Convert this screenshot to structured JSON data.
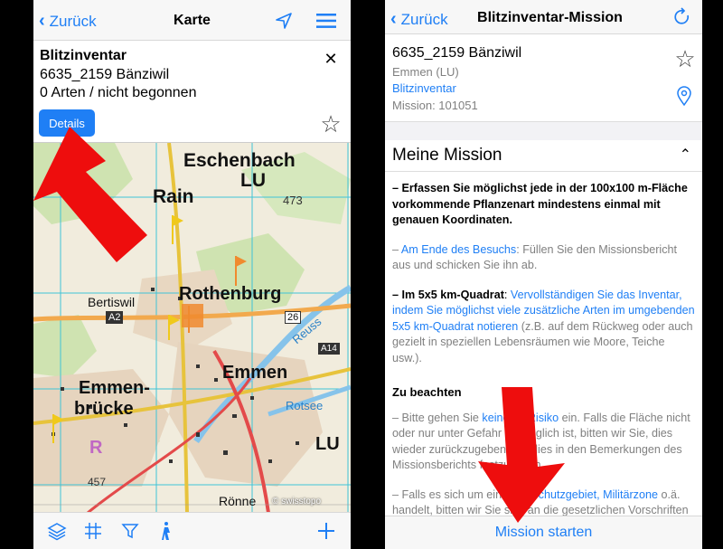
{
  "left": {
    "nav": {
      "back_label": "Zurück",
      "title": "Karte"
    },
    "info": {
      "title": "Blitzinventar",
      "square": "6635_2159 Bänziwil",
      "status": "0 Arten / nicht begonnen",
      "details_label": "Details",
      "close_glyph": "✕",
      "star_glyph": "☆"
    },
    "map": {
      "places": {
        "eschenbach": "Eschenbach",
        "lu1": "LU",
        "rain": "Rain",
        "n473": "473",
        "bertiswil": "Bertiswil",
        "rothenburg": "Rothenburg",
        "a2": "A2",
        "n26": "26",
        "reuss": "Reuss",
        "a14": "A14",
        "emmen": "Emmen",
        "emmenbruecke1": "Emmen-",
        "emmenbruecke2": "brücke",
        "rotsee": "Rotsee",
        "lu2": "LU",
        "n457": "457",
        "roenne": "Rönne",
        "r": "R",
        "copyright": "© swisstopo"
      }
    },
    "toolbar_icons": [
      "layers-icon",
      "grid-icon",
      "filter-icon",
      "walk-icon",
      "plus-icon"
    ],
    "arrow_color": "#ee0d0d"
  },
  "right": {
    "nav": {
      "back_label": "Zurück",
      "title": "Blitzinventar-Mission"
    },
    "summary": {
      "square": "6635_2159 Bänziwil",
      "municipality": "Emmen (LU)",
      "project": "Blitzinventar",
      "mission": "Mission: 101051"
    },
    "section": {
      "title": "Meine Mission",
      "chevron": "⌃"
    },
    "items": {
      "i1": "– Erfassen Sie möglichst jede in der 100x100 m-Fläche vorkommende Pflanzenart mindestens einmal mit genauen Koordinaten.",
      "i2_dash": "– ",
      "i2_link": "Am Ende des Besuchs",
      "i2_rest": ": Füllen Sie den Missionsbericht aus und schicken Sie ihn ab.",
      "i3_bold": "– Im 5x5 km-Quadrat",
      "i3_colon": ": ",
      "i3_link": "Vervollständigen Sie das Inventar, indem Sie möglichst viele zusätzliche Arten im umgebenden 5x5 km-Quadrat notieren",
      "i3_rest": " (z.B. auf dem Rückweg oder auch gezielt in speziellen Lebensräumen wie Moore, Teiche usw.).",
      "zu_beachten": "Zu beachten",
      "n1_a": "– Bitte gehen Sie ",
      "n1_link": "keinerlei Risiko",
      "n1_b": " ein. Falls die Fläche nicht oder nur unter Gefahr zugänglich ist, bitten wir Sie, dies wieder zurückzugeben und dies in den Bemerkungen des Missionsberichts festzuhalten.",
      "n2_a": "– Falls es sich um ein ",
      "n2_link": "Naturschutzgebiet, Militärzone",
      "n2_b": " o.ä. handelt, bitten wir Sie sich an die gesetzlichen Vorschriften zu halten."
    },
    "start_label": "Mission starten"
  }
}
